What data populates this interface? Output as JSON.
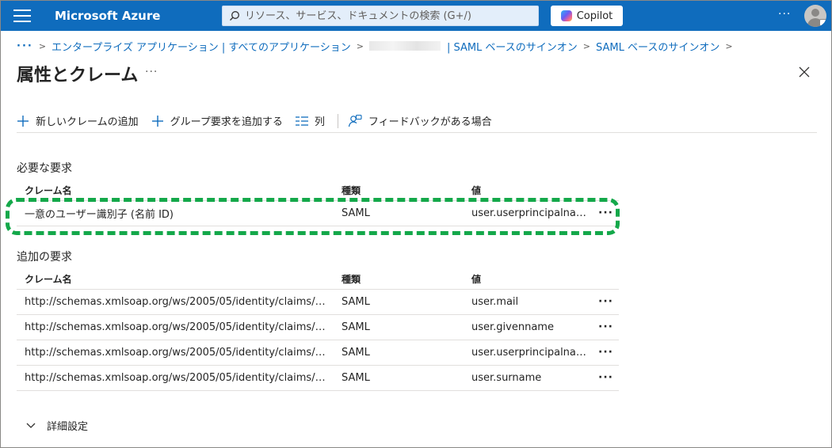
{
  "topbar": {
    "brand": "Microsoft Azure",
    "search_placeholder": "リソース、サービス、ドキュメントの検索 (G+/)",
    "copilot_label": "Copilot",
    "more": "···",
    "accent": "#0f6cbd"
  },
  "breadcrumb": {
    "more": "···",
    "items": [
      "エンタープライズ アプリケーション | すべてのアプリケーション",
      "| SAML ベースのサインオン",
      "SAML ベースのサインオン"
    ]
  },
  "page": {
    "title": "属性とクレーム",
    "more": "···"
  },
  "toolbar": {
    "add_claim": "新しいクレームの追加",
    "add_group_claim": "グループ要求を追加する",
    "columns": "列",
    "feedback": "フィードバックがある場合"
  },
  "required": {
    "heading": "必要な要求",
    "columns": [
      "クレーム名",
      "種類",
      "値"
    ],
    "rows": [
      {
        "name": "一意のユーザー識別子 (名前 ID)",
        "type": "SAML",
        "value": "user.userprincipalnam…",
        "more": "···"
      }
    ]
  },
  "additional": {
    "heading": "追加の要求",
    "columns": [
      "クレーム名",
      "種類",
      "値"
    ],
    "rows": [
      {
        "name": "http://schemas.xmlsoap.org/ws/2005/05/identity/claims/…",
        "type": "SAML",
        "value": "user.mail",
        "more": "···"
      },
      {
        "name": "http://schemas.xmlsoap.org/ws/2005/05/identity/claims/…",
        "type": "SAML",
        "value": "user.givenname",
        "more": "···"
      },
      {
        "name": "http://schemas.xmlsoap.org/ws/2005/05/identity/claims/…",
        "type": "SAML",
        "value": "user.userprincipalname",
        "more": "···"
      },
      {
        "name": "http://schemas.xmlsoap.org/ws/2005/05/identity/claims/…",
        "type": "SAML",
        "value": "user.surname",
        "more": "···"
      }
    ]
  },
  "advanced": {
    "label": "詳細設定"
  },
  "colors": {
    "highlight": "#14a84a",
    "link": "#0f6cbd"
  }
}
